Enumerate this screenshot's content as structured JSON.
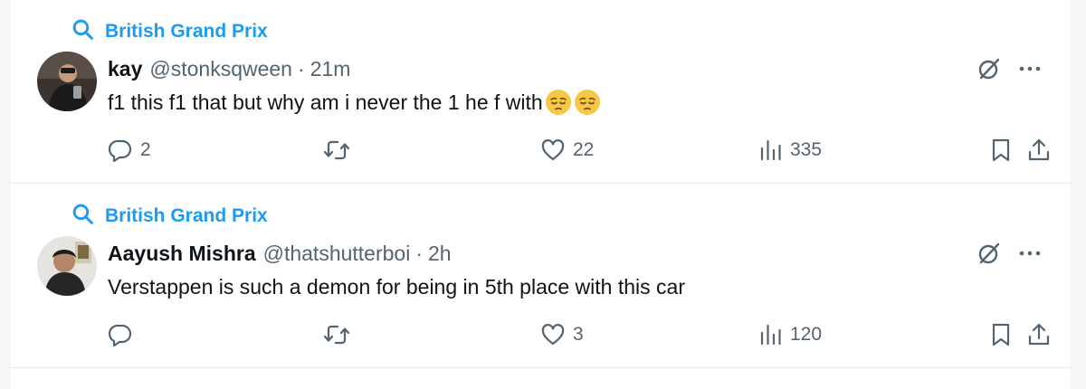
{
  "colors": {
    "accent": "#1d9bf0",
    "text_primary": "#0f1419",
    "text_secondary": "#536471",
    "divider": "#e7ebee"
  },
  "tweets": [
    {
      "context_label": "British Grand Prix",
      "author_name": "kay",
      "handle": "@stonksqween",
      "separator": "·",
      "time": "21m",
      "text": "f1 this f1 that but why am i never the 1 he f with",
      "emojis": [
        "pensive-face-emoji",
        "pensive-face-emoji"
      ],
      "replies": "2",
      "retweets": "",
      "likes": "22",
      "views": "335"
    },
    {
      "context_label": "British Grand Prix",
      "author_name": "Aayush Mishra",
      "handle": "@thatshutterboi",
      "separator": "·",
      "time": "2h",
      "text": "Verstappen is such a demon for being in 5th place with this car",
      "emojis": [],
      "replies": "",
      "retweets": "",
      "likes": "3",
      "views": "120"
    }
  ],
  "icons": {
    "context": "search-icon",
    "grok": "grok-slash-icon",
    "more": "more-dots-icon",
    "reply": "reply-bubble-icon",
    "retweet": "retweet-icon",
    "like": "heart-icon",
    "views": "views-bar-chart-icon",
    "bookmark": "bookmark-icon",
    "share": "share-upload-icon"
  }
}
